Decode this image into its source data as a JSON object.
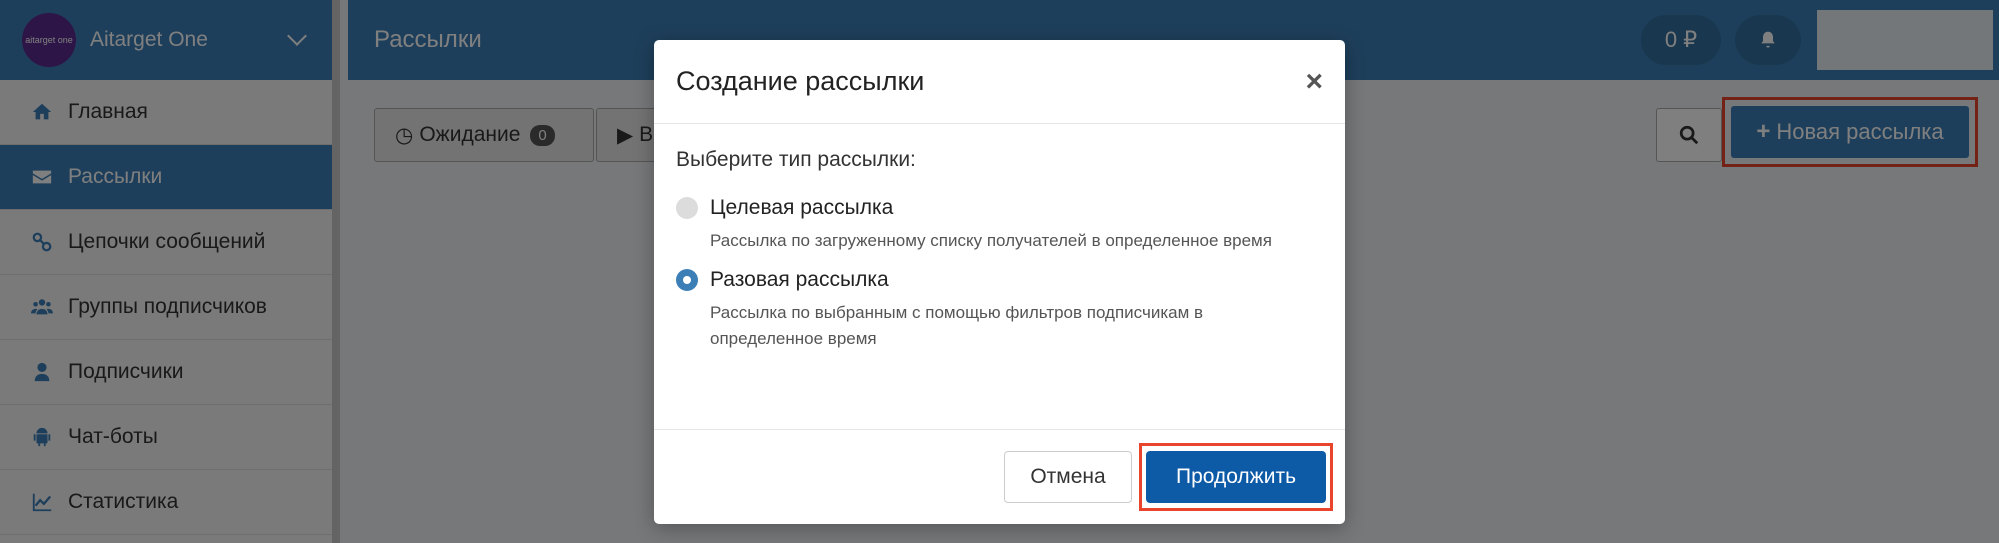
{
  "app": {
    "logo_text": "aitarget one",
    "name": "Aitarget One"
  },
  "sidebar": {
    "items": [
      {
        "label": "Главная",
        "icon": "home-icon"
      },
      {
        "label": "Рассылки",
        "icon": "envelope-icon",
        "active": true
      },
      {
        "label": "Цепочки сообщений",
        "icon": "link-icon"
      },
      {
        "label": "Группы подписчиков",
        "icon": "users-icon"
      },
      {
        "label": "Подписчики",
        "icon": "user-icon"
      },
      {
        "label": "Чат-боты",
        "icon": "android-icon"
      },
      {
        "label": "Статистика",
        "icon": "chart-line-icon"
      }
    ]
  },
  "header": {
    "title": "Рассылки",
    "balance": "0 ₽"
  },
  "toolbar": {
    "filter_waiting_label": "Ожидание",
    "filter_waiting_count": "0",
    "filter_second_label": "В",
    "new_button_label": "Новая рассылка"
  },
  "modal": {
    "title": "Создание рассылки",
    "close_label": "×",
    "prompt": "Выберите тип рассылки:",
    "options": [
      {
        "title": "Целевая рассылка",
        "description": "Рассылка по загруженному списку получателей в определенное время",
        "checked": false
      },
      {
        "title": "Разовая рассылка",
        "description": "Рассылка по выбранным с помощью фильтров подписчикам в определенное время",
        "checked": true
      }
    ],
    "cancel_label": "Отмена",
    "continue_label": "Продолжить"
  },
  "colors": {
    "primary": "#3c7fb7",
    "highlight": "#e8452c",
    "continue": "#0d5aa7"
  }
}
